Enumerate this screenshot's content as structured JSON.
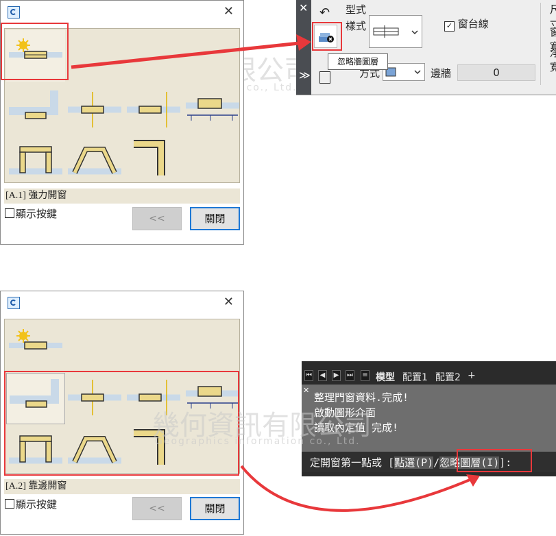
{
  "dialog1": {
    "close_glyph": "✕",
    "caption": "[A.1] 強力開窗",
    "checkbox_label": "顯示按鍵",
    "prev_label": "<<",
    "close_label": "關閉"
  },
  "dialog2": {
    "close_glyph": "✕",
    "caption": "[A.2] 靠邊開窗",
    "checkbox_label": "顯示按鍵",
    "prev_label": "<<",
    "close_label": "關閉"
  },
  "toolbar": {
    "group_label": "型式",
    "style_label": "樣式",
    "sill_checkbox": "窗台線",
    "method_label": "方式",
    "edge_label": "邊牆",
    "edge_value": "0",
    "size_label": "尺寸",
    "width_label": "窗寬",
    "clear_label": "淨寬",
    "tooltip": "忽略牆圖層"
  },
  "command": {
    "tabs": [
      "模型",
      "配置1",
      "配置2",
      "+"
    ],
    "history": [
      "整理門窗資料.完成!",
      "啟動圖形介面",
      "讀取內定值 完成!"
    ],
    "prompt_prefix": "定開窗第一點或 [",
    "option1": "點選(P)",
    "sep": "/",
    "option2": "忽略圖層(I)",
    "prompt_suffix": "]:"
  },
  "watermark": {
    "text": "幾何資訊有限公司",
    "sub": "Geographics information co., Ltd."
  },
  "colors": {
    "highlight_red": "#e8383b",
    "palette_bg": "#ebe6d6",
    "button_blue": "#1e78d6"
  }
}
